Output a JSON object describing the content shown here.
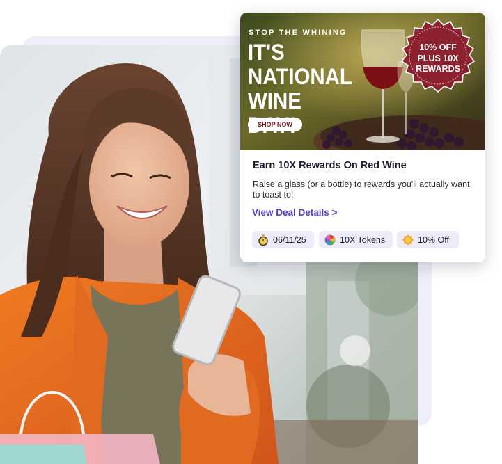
{
  "promo": {
    "kicker": "STOP THE WHINING",
    "headline": "IT'S NATIONAL WINE DAY!",
    "shop_button": "SHOP NOW",
    "seal": {
      "line1": "10% OFF",
      "line2": "PLUS 10X",
      "line3": "REWARDS"
    },
    "title": "Earn 10X Rewards On Red Wine",
    "description": "Raise a glass (or a bottle) to rewards you'll actually want to toast to!",
    "link": "View Deal Details >",
    "chips": [
      {
        "icon": "stopwatch-icon",
        "label": "06/11/25"
      },
      {
        "icon": "token-wheel-icon",
        "label": "10X Tokens"
      },
      {
        "icon": "discount-badge-icon",
        "label": "10% Off"
      }
    ]
  },
  "colors": {
    "accent_link": "#4d3fc2",
    "seal": "#8c2230",
    "chip_bg": "#ecebf7",
    "shirt": "#e4681c"
  }
}
